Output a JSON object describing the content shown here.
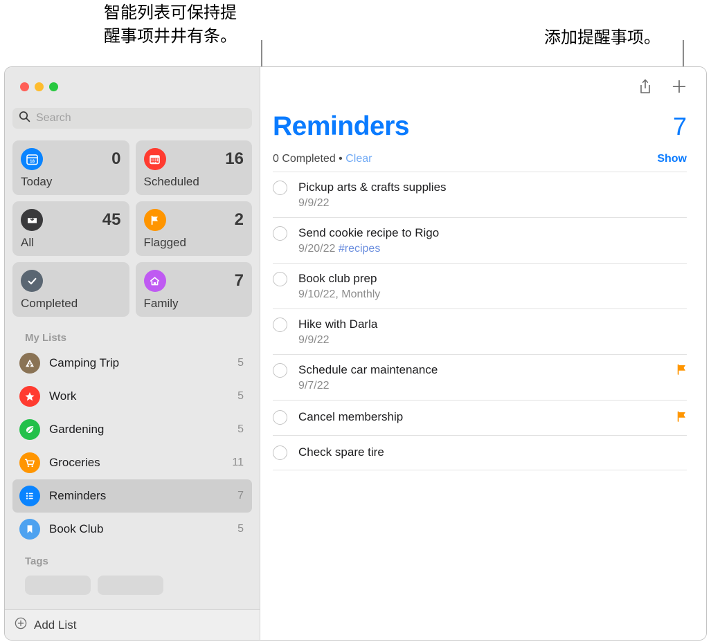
{
  "callouts": {
    "left": "智能列表可保持提\n醒事项井井有条。",
    "right": "添加提醒事项。"
  },
  "window": {
    "traffic_lights": [
      {
        "name": "close",
        "color": "#ff5f57"
      },
      {
        "name": "minimize",
        "color": "#febc2e"
      },
      {
        "name": "zoom",
        "color": "#28c840"
      }
    ]
  },
  "sidebar": {
    "search": {
      "placeholder": "Search",
      "value": ""
    },
    "smart_lists": [
      {
        "label": "Today",
        "count": "0",
        "icon": "calendar-day-icon",
        "color": "#0a84ff"
      },
      {
        "label": "Scheduled",
        "count": "16",
        "icon": "calendar-icon",
        "color": "#ff3b30"
      },
      {
        "label": "All",
        "count": "45",
        "icon": "inbox-tray-icon",
        "color": "#3a3a3c"
      },
      {
        "label": "Flagged",
        "count": "2",
        "icon": "flag-icon",
        "color": "#ff9500"
      },
      {
        "label": "Completed",
        "count": "",
        "icon": "checkmark-icon",
        "color": "#5a6672"
      },
      {
        "label": "Family",
        "count": "7",
        "icon": "house-icon",
        "color": "#bf5af2"
      }
    ],
    "my_lists_header": "My Lists",
    "lists": [
      {
        "name": "Camping Trip",
        "count": "5",
        "icon": "tent-icon",
        "color": "#8a7355",
        "selected": false
      },
      {
        "name": "Work",
        "count": "5",
        "icon": "star-icon",
        "color": "#ff3b30",
        "selected": false
      },
      {
        "name": "Gardening",
        "count": "5",
        "icon": "leaf-icon",
        "color": "#23c04a",
        "selected": false
      },
      {
        "name": "Groceries",
        "count": "11",
        "icon": "cart-icon",
        "color": "#ff9500",
        "selected": false
      },
      {
        "name": "Reminders",
        "count": "7",
        "icon": "list-bullet-icon",
        "color": "#0a84ff",
        "selected": true
      },
      {
        "name": "Book Club",
        "count": "5",
        "icon": "bookmark-icon",
        "color": "#4da2f0",
        "selected": false
      }
    ],
    "tags_header": "Tags",
    "tags": [
      {
        "label": ""
      },
      {
        "label": ""
      }
    ],
    "footer": {
      "add_list_label": "Add List"
    }
  },
  "main": {
    "toolbar": {
      "share_icon": "share-icon",
      "add_icon": "plus-icon"
    },
    "title": "Reminders",
    "total": "7",
    "completed_text": "0 Completed",
    "separator": "•",
    "clear_label": "Clear",
    "show_label": "Show",
    "accent_color": "#0a7bff",
    "reminders": [
      {
        "title": "Pickup arts & crafts supplies",
        "date": "9/9/22",
        "tag": "",
        "flagged": false
      },
      {
        "title": "Send cookie recipe to Rigo",
        "date": "9/20/22",
        "tag": "#recipes",
        "flagged": false
      },
      {
        "title": "Book club prep",
        "date": "9/10/22, Monthly",
        "tag": "",
        "flagged": false
      },
      {
        "title": "Hike with Darla",
        "date": "9/9/22",
        "tag": "",
        "flagged": false
      },
      {
        "title": "Schedule car maintenance",
        "date": "9/7/22",
        "tag": "",
        "flagged": true
      },
      {
        "title": "Cancel membership",
        "date": "",
        "tag": "",
        "flagged": true
      },
      {
        "title": "Check spare tire",
        "date": "",
        "tag": "",
        "flagged": false
      }
    ]
  }
}
